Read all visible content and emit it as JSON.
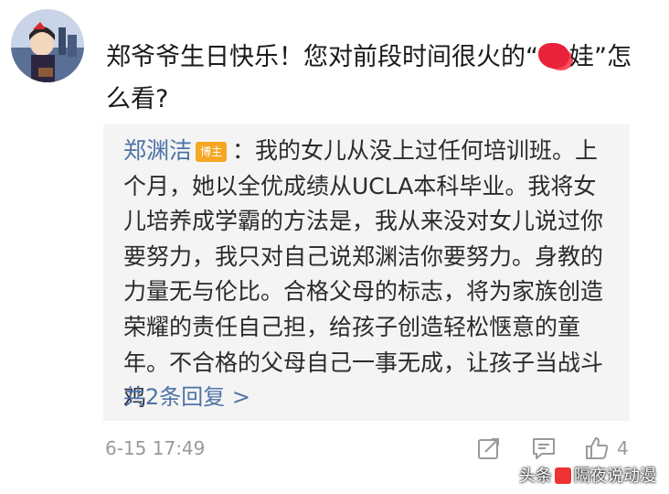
{
  "comment": {
    "question_before": "郑爷爷生日快乐！您对前段时间很火的“",
    "question_after": "娃”怎么看?"
  },
  "quote": {
    "author": "郑渊洁",
    "badge": "博主",
    "text": "：我的女儿从没上过任何培训班。上个月，她以全优成绩从UCLA本科毕业。我将女儿培养成学霸的方法是，我从来没对女儿说过你要努力，我只对自己说郑渊洁你要努力。身教的力量无与伦比。合格父母的标志，将为家族创造荣耀的责任自己担，给孩子创造轻松惬意的童年。不合格的父母自己一事无成，让孩子当战斗鸡",
    "replies_link": "共2条回复 >"
  },
  "meta": {
    "timestamp": "6-15 17:49",
    "like_count": "4"
  },
  "watermark": {
    "prefix": "头条",
    "name": "隔夜说动漫"
  },
  "colors": {
    "link_blue": "#4d73a6",
    "badge_orange": "#f5a623",
    "redaction_red": "#e8233a",
    "quote_bg": "#f4f4f4"
  },
  "icons": [
    "avatar-illustration",
    "share-icon",
    "comment-icon",
    "like-thumb-icon"
  ]
}
